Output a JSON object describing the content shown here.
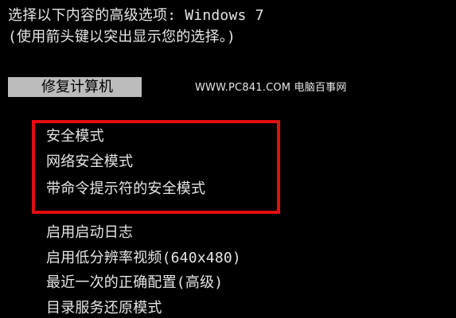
{
  "header": {
    "line1": "选择以下内容的高级选项: Windows 7",
    "line2": "(使用箭头键以突出显示您的选择。)"
  },
  "selected_option": "修复计算机",
  "watermark": "WWW.PC841.COM 电脑百事网",
  "highlighted_options": [
    "安全模式",
    "网络安全模式",
    "带命令提示符的安全模式"
  ],
  "other_options": [
    "启用启动日志",
    "启用低分辨率视频(640x480)",
    "最近一次的正确配置(高级)",
    "目录服务还原模式"
  ],
  "colors": {
    "background": "#000000",
    "text": "#e6e6e6",
    "selection_background": "#bcbcbc",
    "highlight_border": "#e10f0f"
  }
}
